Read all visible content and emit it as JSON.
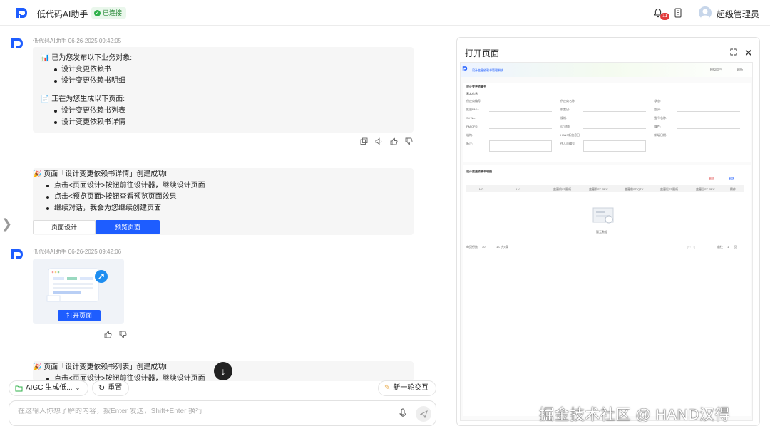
{
  "header": {
    "app_title": "低代码AI助手",
    "status": "已连接",
    "notif_count": "11",
    "user_name": "超级管理员"
  },
  "messages": {
    "m1": {
      "meta": "低代码AI助手 06-26-2025 09:42:05",
      "line1": "📊 已为您发布以下业务对象:",
      "objects": [
        "设计变更依赖书",
        "设计变更依赖书明细"
      ],
      "line2": "📄 正在为您生成以下页面:",
      "pages": [
        "设计变更依赖书列表",
        "设计变更依赖书详情"
      ]
    },
    "m2": {
      "title": "🎉 页面「设计变更依赖书详情」创建成功!",
      "items": [
        "点击<页面设计>按钮前往设计器，继续设计页面",
        "点击<预览页面>按钮查看预览页面效果",
        "继续对话，我会为您继续创建页面"
      ],
      "btn_design": "页面设计",
      "btn_preview": "预览页面"
    },
    "m3": {
      "meta": "低代码AI助手 06-26-2025 09:42:06",
      "open_btn": "打开页面"
    },
    "m4": {
      "title": "🎉 页面「设计变更依赖书列表」创建成功!",
      "item1": "点击<页面设计>按钮前往设计器，继续设计页面"
    }
  },
  "toolbar": {
    "aigc": "AIGC 生成低...",
    "reset": "重置",
    "new_round": "新一轮交互"
  },
  "input": {
    "placeholder": "在这输入你想了解的内容，按Enter 发送，Shift+Enter 换行"
  },
  "panel": {
    "title": "打开页面",
    "preview": {
      "system_name": "设计变更依赖书管理系统",
      "user": "模拟用户",
      "refresh": "刷新",
      "section1": "设计变更依赖书",
      "basic_info": "基本信息",
      "form_labels": [
        "供应商编号:",
        "供应商名称:",
        "状态:",
        "批量RMV:",
        "前置日:",
        "部分:",
        "SV No:",
        "规格:",
        "型号名称:",
        "PM CP.2:",
        "ST材质:",
        "属性:",
        "机构:",
        "HANS新信息日:",
        "新填日期:",
        "备注:",
        "任人员编号:"
      ],
      "section2": "设计变更依赖书明细",
      "del": "删除",
      "add": "新增",
      "columns": [
        "MD",
        "LV",
        "变更前ST图纸",
        "变更前ST REV",
        "变更前ST QTY",
        "变更后ST图纸",
        "变更后ST REV",
        "操作"
      ],
      "empty": "暂无数据",
      "pager_left": "每页行数",
      "pager_size": "30",
      "pager_range": "1-0 共0条",
      "pager_go": "前往",
      "pager_page": "1",
      "pager_unit": "页"
    }
  },
  "watermark": "掘金技术社区 @ HAND汉得",
  "colors": {
    "primary": "#1e5dff",
    "success": "#2fb14a",
    "badge": "#e23b3b"
  }
}
